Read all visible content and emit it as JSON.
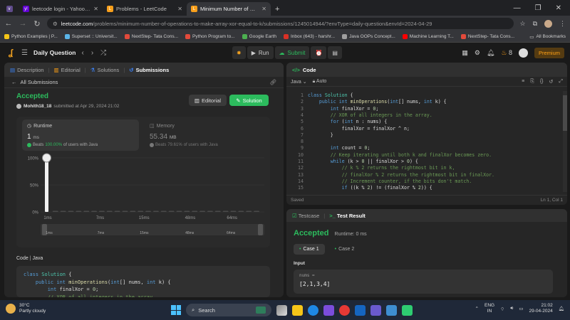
{
  "browser": {
    "tabs": [
      {
        "title": "leetcode login - Yahoo India Search",
        "favicon_color": "#6001d2",
        "favicon_text": "y!"
      },
      {
        "title": "Problems - LeetCode",
        "favicon_color": "#f89f1b",
        "favicon_text": "L"
      },
      {
        "title": "Minimum Number of Operations",
        "favicon_color": "#f89f1b",
        "favicon_text": "L"
      }
    ],
    "url_host": "leetcode.com",
    "url_path": "/problems/minimum-number-of-operations-to-make-array-xor-equal-to-k/submissions/1245014944/?envType=daily-question&envId=2024-04-29",
    "bookmarks": [
      {
        "label": "Python Examples | P...",
        "color": "#f5c518"
      },
      {
        "label": "Superset :: Universit...",
        "color": "#5ab4e8"
      },
      {
        "label": "NextStep- Tata Cons...",
        "color": "#e24a3b"
      },
      {
        "label": "Python Program to...",
        "color": "#e24a3b"
      },
      {
        "label": "Google Earth",
        "color": "#4caf50"
      },
      {
        "label": "Inbox (643) - harshr...",
        "color": "#d93025"
      },
      {
        "label": "Java OOPs Concept...",
        "color": "#9e9e9e"
      },
      {
        "label": "Machine Learning T...",
        "color": "#ff0000"
      },
      {
        "label": "NextStep- Tata Cons...",
        "color": "#e24a3b"
      }
    ],
    "all_bookmarks": "All Bookmarks"
  },
  "lc_nav": {
    "daily_question": "Daily Question",
    "run": "Run",
    "submit": "Submit",
    "streak": "8",
    "premium": "Premium"
  },
  "left_tabs": [
    {
      "label": "Description",
      "icon": "description-icon"
    },
    {
      "label": "Editorial",
      "icon": "book-icon"
    },
    {
      "label": "Solutions",
      "icon": "flask-icon"
    },
    {
      "label": "Submissions",
      "icon": "history-icon"
    }
  ],
  "all_submissions": "All Submissions",
  "submission": {
    "status": "Accepted",
    "user": "Mohith18_18",
    "submitted_text": "submitted at Apr 29, 2024 21:02",
    "editorial_btn": "Editorial",
    "solution_btn": "Solution",
    "runtime_label": "Runtime",
    "runtime_value": "1",
    "runtime_unit": "ms",
    "runtime_beats_prefix": "Beats",
    "runtime_beats_pct": "100.00%",
    "runtime_beats_suffix": "of users with Java",
    "memory_label": "Memory",
    "memory_value": "55.34",
    "memory_unit": "MB",
    "memory_beats_prefix": "Beats",
    "memory_beats_pct": "79.61%",
    "memory_beats_suffix": "of users with Java",
    "code_label": "Code",
    "code_lang": "Java"
  },
  "chart_data": {
    "type": "bar",
    "ylabel_ticks": [
      "100%",
      "50%",
      "0%"
    ],
    "xticks": [
      "1ms",
      "7ms",
      "15ms",
      "48ms",
      "64ms"
    ],
    "mini_ticks": [
      "1ms",
      "7ms",
      "15ms",
      "48ms",
      "64ms"
    ],
    "values": [
      100,
      0,
      0,
      0,
      0,
      0,
      0,
      0,
      0,
      0,
      0,
      0,
      0,
      0,
      0,
      0,
      0,
      0,
      0,
      0,
      0,
      0,
      0,
      0,
      0,
      0,
      0,
      0
    ],
    "ylim": [
      0,
      100
    ],
    "highlight_index": 0
  },
  "code_panel": {
    "title": "Code",
    "language": "Java",
    "mode": "Auto",
    "saved": "Saved",
    "cursor": "Ln 1, Col 1",
    "lines": [
      "class Solution {",
      "    public int minOperations(int[] nums, int k) {",
      "        int finalXor = 0;",
      "        // XOR of all integers in the array.",
      "        for (int n : nums) {",
      "            finalXor = finalXor ^ n;",
      "        }",
      "",
      "        int count = 0;",
      "        // Keep iterating until both k and finalXor becomes zero.",
      "        while (k > 0 || finalXor > 0) {",
      "            // k % 2 returns the rightmost bit in k,",
      "            // finalXor % 2 returns the rightmost bit in finalXor.",
      "            // Increment counter, if the bits don't match.",
      "            if ((k % 2) != (finalXor % 2)) {"
    ]
  },
  "left_code_lines": [
    "class Solution {",
    "    public int minOperations(int[] nums, int k) {",
    "        int finalXor = 0;",
    "        // XOR of all integers in the array."
  ],
  "test_panel": {
    "testcase_tab": "Testcase",
    "result_tab": "Test Result",
    "status": "Accepted",
    "runtime": "Runtime: 0 ms",
    "cases": [
      "Case 1",
      "Case 2"
    ],
    "input_label": "Input",
    "var_name": "nums =",
    "var_value": "[2,1,3,4]"
  },
  "taskbar": {
    "temp": "30°C",
    "weather": "Partly cloudy",
    "search": "Search",
    "lang1": "ENG",
    "lang2": "IN",
    "time": "21:02",
    "date": "29-04-2024"
  }
}
